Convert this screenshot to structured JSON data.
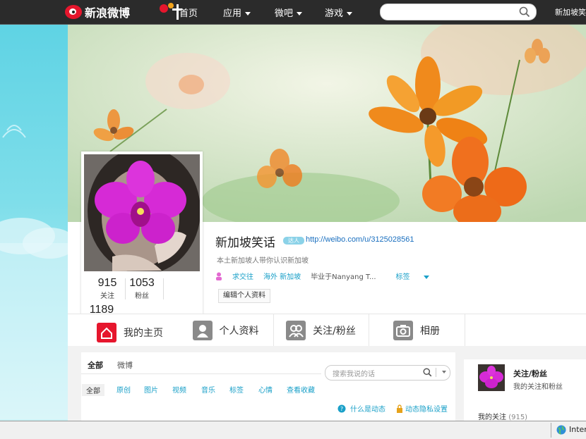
{
  "topnav": {
    "logo_text": "新浪微博",
    "items": [
      {
        "label": "首页"
      },
      {
        "label": "应用"
      },
      {
        "label": "微吧"
      },
      {
        "label": "游戏"
      }
    ],
    "search": {
      "placeholder": ""
    },
    "nickname": "新加坡笑"
  },
  "profile": {
    "name": "新加坡笑话",
    "verified_badge": "达人",
    "url": "http://weibo.com/u/3125028561",
    "bio": "本土新加坡人带你认识新加坡",
    "meta": {
      "relationship": "求交往",
      "location": "海外 新加坡",
      "school": "毕业于Nanyang T...",
      "tags": "标签"
    },
    "edit_label": "编辑个人资料",
    "counts": {
      "following": "915",
      "following_label": "关注",
      "fans": "1053",
      "fans_label": "粉丝",
      "weibo": "1189"
    }
  },
  "tabs": [
    {
      "label": "我的主页",
      "icon": "home-icon"
    },
    {
      "label": "个人资料",
      "icon": "profile-icon"
    },
    {
      "label": "关注/粉丝",
      "icon": "people-icon"
    },
    {
      "label": "相册",
      "icon": "camera-icon"
    }
  ],
  "feed": {
    "tabs": [
      {
        "label": "全部"
      },
      {
        "label": "微博"
      }
    ],
    "search_placeholder": "搜索我说的话",
    "categories": [
      "全部",
      "原创",
      "图片",
      "视频",
      "音乐",
      "标签",
      "心情",
      "查看收藏"
    ],
    "help_link": "什么是动态",
    "privacy_link": "动态隐私设置"
  },
  "sidebar": {
    "title": "关注/粉丝",
    "subtitle": "我的关注和粉丝",
    "my_following": "我的关注",
    "my_following_count": "(915)"
  },
  "statusbar": {
    "zone": "Inter"
  },
  "colors": {
    "accent": "#1aa0c8",
    "weibo_red": "#e6162d",
    "topbar": "#2b2b2b"
  }
}
